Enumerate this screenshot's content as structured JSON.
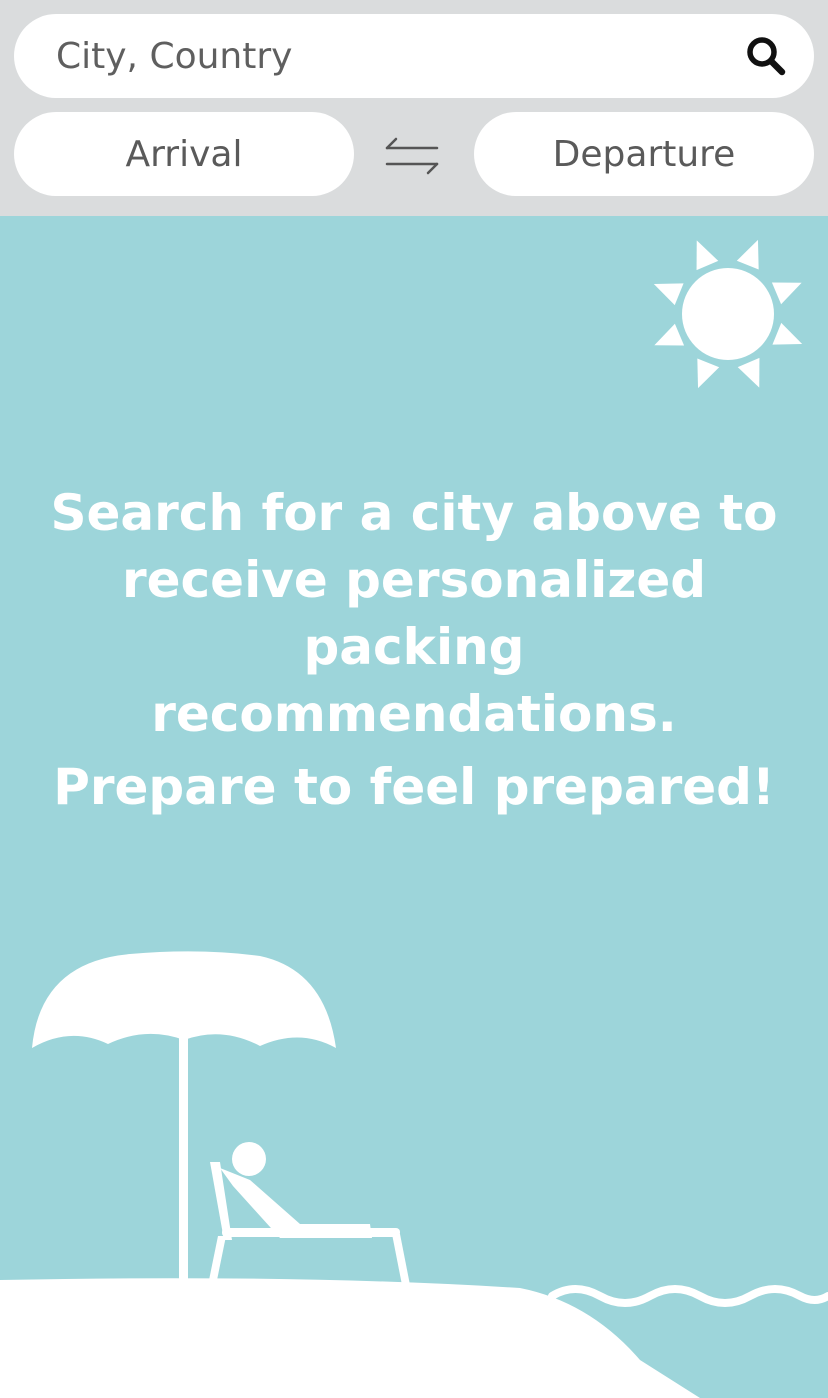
{
  "search": {
    "placeholder": "City, Country",
    "icon": "search-icon"
  },
  "dates": {
    "arrival_label": "Arrival",
    "departure_label": "Departure",
    "swap_icon": "swap-arrows-icon"
  },
  "main": {
    "message": "Search for a city above to receive personalized packing recommendations.",
    "tagline": "Prepare to feel prepared!"
  },
  "colors": {
    "header_bg": "#dadcdd",
    "main_bg": "#9dd5da",
    "input_bg": "#ffffff",
    "text_gray": "#5a5a5a"
  }
}
